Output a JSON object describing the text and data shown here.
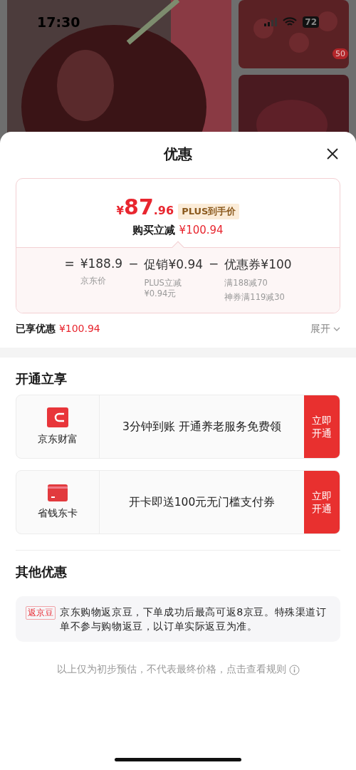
{
  "status_bar": {
    "time": "17:30",
    "battery": "72"
  },
  "background": {
    "kind": "picture",
    "thumbnail_badge": "50"
  },
  "sheet": {
    "title": "优惠"
  },
  "price_card": {
    "currency": "¥",
    "price_int": "87",
    "price_dec": ".96",
    "badge": "PLUS到手价",
    "saving_label": "购买立减",
    "saving_value": "¥100.94",
    "terms": [
      {
        "op": "=",
        "value": "¥188.9",
        "notes": [
          "京东价"
        ]
      },
      {
        "op": "−",
        "value": "促销¥0.94",
        "notes": [
          "PLUS立减",
          "¥0.94元"
        ]
      },
      {
        "op": "−",
        "value": "优惠券¥100",
        "notes": [
          "满188减70",
          "神券满119减30"
        ]
      }
    ]
  },
  "enjoyed": {
    "label": "已享优惠",
    "value": "¥100.94",
    "toggle": "展开"
  },
  "open_section": {
    "title": "开通立享",
    "offers": [
      {
        "kind": "wallet",
        "name": "京东财富",
        "text": "3分钟到账 开通养老服务免费领",
        "button": "立即开通"
      },
      {
        "kind": "card",
        "name": "省钱东卡",
        "text": "开卡即送100元无门槛支付券",
        "button": "立即开通"
      }
    ]
  },
  "other_section": {
    "title": "其他优惠",
    "tag": "返京豆",
    "text": "京东购物返京豆，下单成功后最高可返8京豆。特殊渠道订单不参与购物返豆，以订单实际返豆为准。"
  },
  "footer": "以上仅为初步预估，不代表最终价格，点击查看规则"
}
